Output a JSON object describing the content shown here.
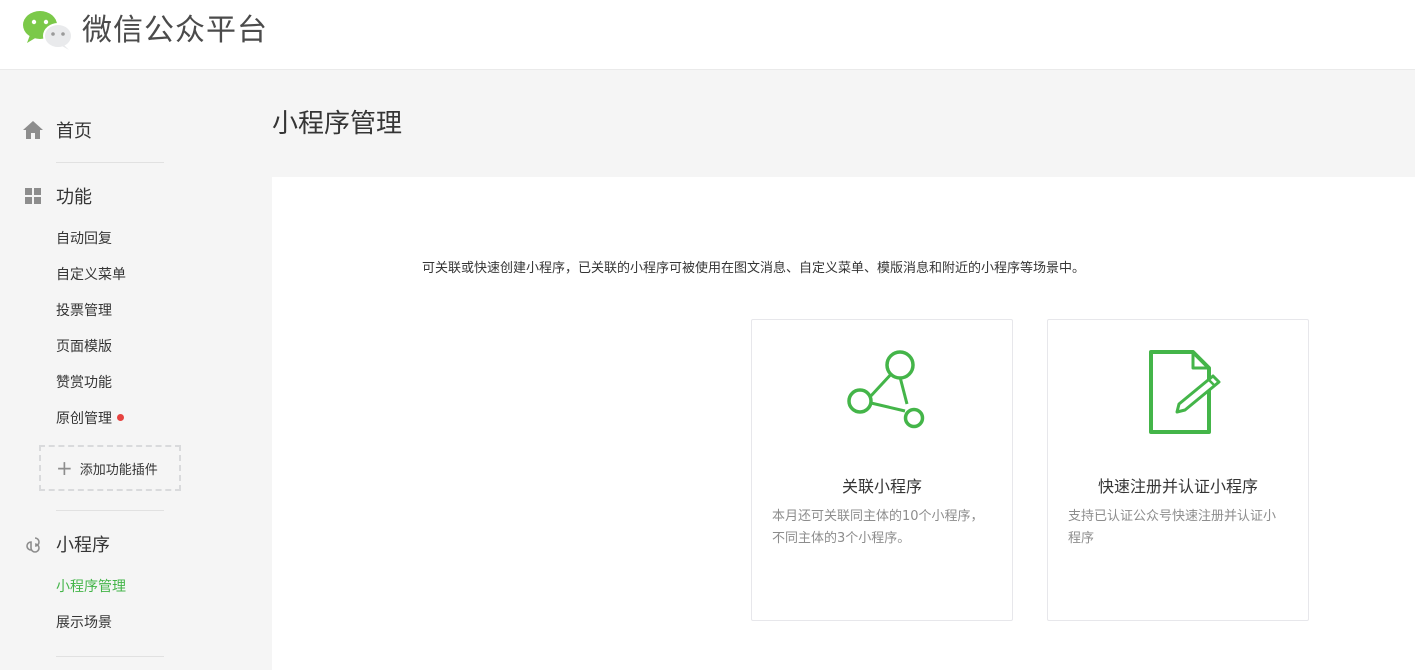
{
  "header": {
    "app_title": "微信公众平台"
  },
  "sidebar": {
    "home": {
      "label": "首页",
      "icon": "home-icon"
    },
    "features": {
      "label": "功能",
      "icon": "grid-icon",
      "items": [
        {
          "label": "自动回复"
        },
        {
          "label": "自定义菜单"
        },
        {
          "label": "投票管理"
        },
        {
          "label": "页面模版"
        },
        {
          "label": "赞赏功能"
        },
        {
          "label": "原创管理",
          "badge": "red-dot"
        }
      ],
      "add_plugin_label": "添加功能插件"
    },
    "mini_program": {
      "label": "小程序",
      "icon": "link-icon",
      "items": [
        {
          "label": "小程序管理",
          "active": true
        },
        {
          "label": "展示场景"
        }
      ]
    }
  },
  "main": {
    "page_title": "小程序管理",
    "description": "可关联或快速创建小程序，已关联的小程序可被使用在图文消息、自定义菜单、模版消息和附近的小程序等场景中。",
    "cards": [
      {
        "icon": "link-nodes-icon",
        "title": "关联小程序",
        "description": "本月还可关联同主体的10个小程序，不同主体的3个小程序。"
      },
      {
        "icon": "document-edit-icon",
        "title": "快速注册并认证小程序",
        "description": "支持已认证公众号快速注册并认证小程序"
      }
    ]
  },
  "colors": {
    "brand_green": "#44b549",
    "badge_red": "#e64340",
    "muted_text": "#8d8d8d"
  }
}
